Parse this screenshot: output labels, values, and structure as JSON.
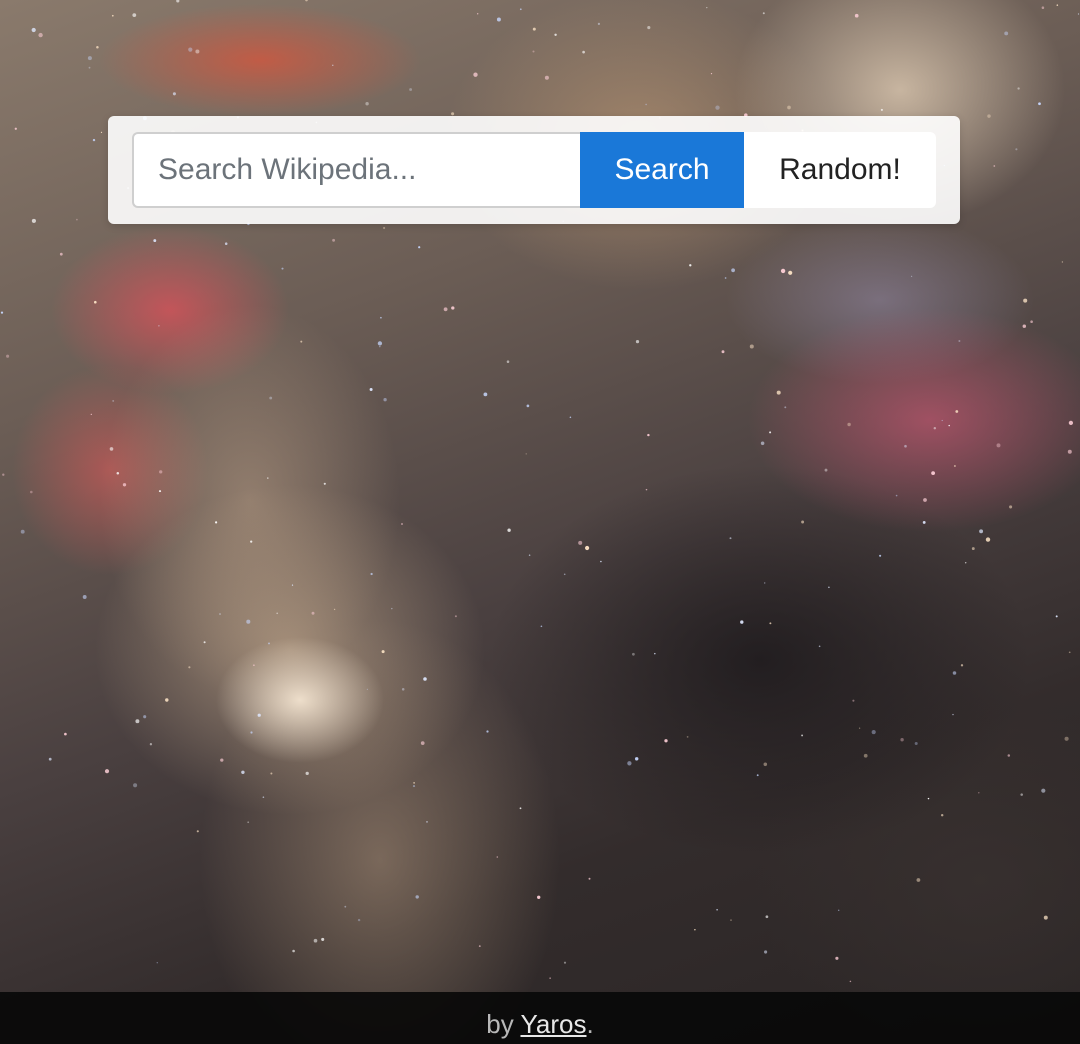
{
  "search": {
    "placeholder": "Search Wikipedia...",
    "value": "",
    "search_label": "Search",
    "random_label": "Random!"
  },
  "footer": {
    "prefix": "by ",
    "author_link": "Yaros",
    "suffix": "."
  },
  "colors": {
    "accent": "#1a78d8",
    "footer_bg": "#080808"
  }
}
